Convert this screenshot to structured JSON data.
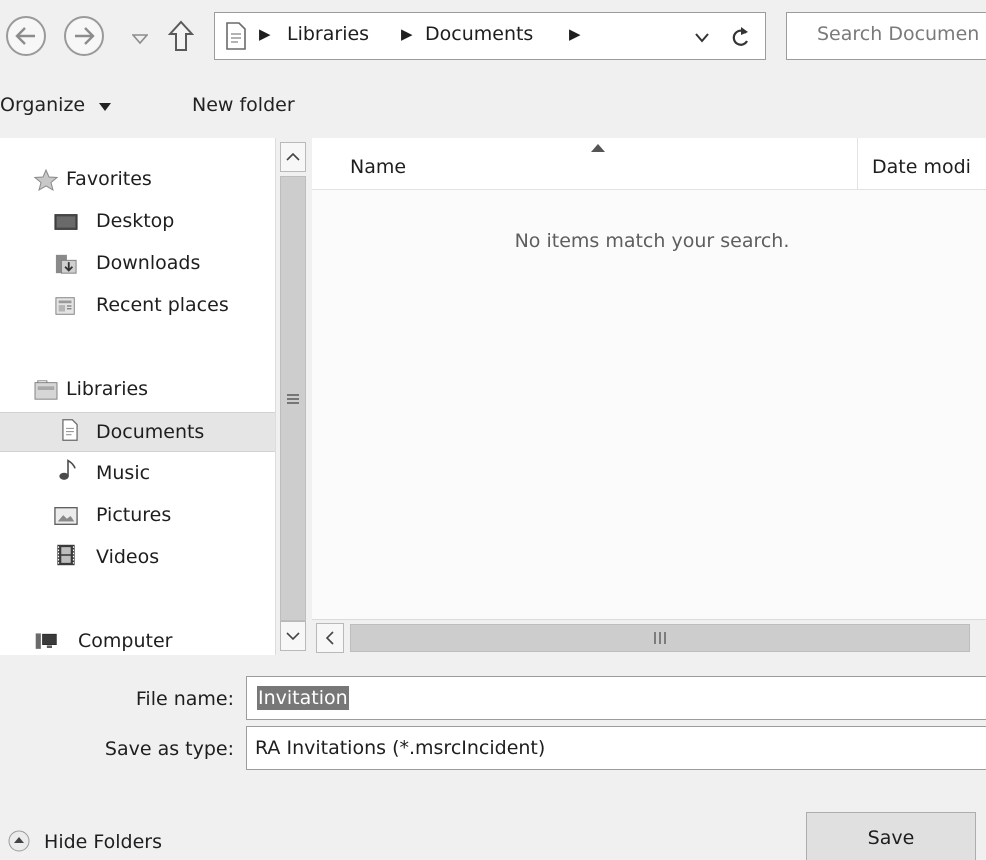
{
  "address": {
    "crumbs": [
      "Libraries",
      "Documents"
    ],
    "search_placeholder": "Search Documen"
  },
  "toolbar": {
    "organize": "Organize",
    "new_folder": "New folder"
  },
  "nav": {
    "items": [
      {
        "label": "Favorites",
        "icon": "star-icon"
      },
      {
        "label": "Desktop",
        "icon": "desktop-icon"
      },
      {
        "label": "Downloads",
        "icon": "downloads-icon"
      },
      {
        "label": "Recent places",
        "icon": "recent-places-icon"
      },
      {
        "label": "Libraries",
        "icon": "libraries-icon"
      },
      {
        "label": "Documents",
        "icon": "documents-icon",
        "selected": true
      },
      {
        "label": "Music",
        "icon": "music-icon"
      },
      {
        "label": "Pictures",
        "icon": "pictures-icon"
      },
      {
        "label": "Videos",
        "icon": "videos-icon"
      },
      {
        "label": "Computer",
        "icon": "computer-icon"
      }
    ]
  },
  "list": {
    "columns": [
      "Name",
      "Date modi"
    ],
    "empty_message": "No items match your search."
  },
  "form": {
    "file_name_label": "File name:",
    "file_name_value": "Invitation",
    "save_type_label": "Save as type:",
    "save_type_value": "RA Invitations (*.msrcIncident)"
  },
  "footer": {
    "hide_folders": "Hide Folders",
    "save": "Save"
  }
}
